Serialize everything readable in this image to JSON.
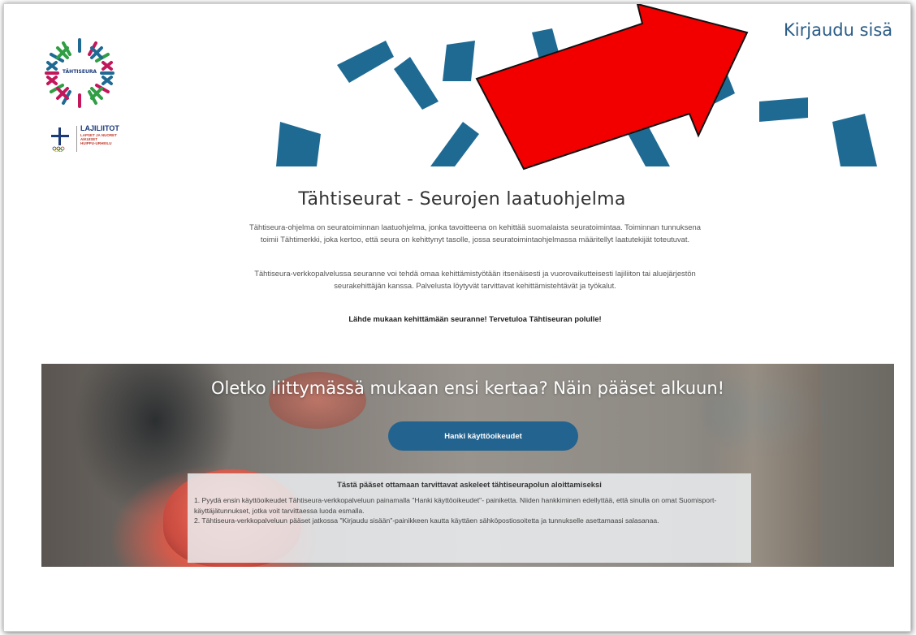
{
  "header": {
    "login_link": "Kirjaudu sisä",
    "logo_text": "TÄHTISEURA",
    "partner": {
      "title": "LAJILIITOT",
      "sub_lines": [
        "LAPSET JA NUORET",
        "AIKUISET",
        "HUIPPU-URHEILU"
      ]
    }
  },
  "intro": {
    "title": "Tähtiseurat - Seurojen laatuohjelma",
    "paragraph1": "Tähtiseura-ohjelma on seuratoiminnan laatuohjelma, jonka tavoitteena on kehittää suomalaista seuratoimintaa. Toiminnan tunnuksena toimii Tähtimerkki, joka kertoo, että seura on kehittynyt tasolle, jossa seuratoimintaohjelmassa määritellyt laatutekijät toteutuvat.",
    "paragraph2": "Tähtiseura-verkkopalvelussa seuranne voi tehdä omaa kehittämistyötään itsenäisesti ja vuorovaikutteisesti lajiliiton tai aluejärjestön seurakehittäjän kanssa. Palvelusta löytyvät tarvittavat kehittämistehtävät ja työkalut.",
    "paragraph3": "Lähde mukaan kehittämään seuranne! Tervetuloa Tähtiseuran polulle!"
  },
  "banner": {
    "heading": "Oletko liittymässä mukaan ensi kertaa? Näin pääset alkuun!",
    "button_label": "Hanki käyttöoikeudet",
    "info_title": "Tästä pääset ottamaan tarvittavat askeleet tähtiseurapolun aloittamiseksi",
    "info_lines": [
      "1. Pyydä ensin käyttöoikeudet Tähtiseura-verkkopalveluun painamalla \"Hanki käyttöoikeudet\"- painiketta. Niiden hankkiminen edellyttää, että sinulla on omat Suomisport-käyttäjätunnukset, jotka voit tarvittaessa luoda esmalla.",
      "2. Tähtiseura-verkkopalveluun pääset jatkossa \"Kirjaudu sisään\"-painikkeen kautta käyttäen sähköpostiosoitetta ja tunnukselle asettamaasi salasanaa."
    ]
  },
  "colors": {
    "brand_blue": "#1f6a93",
    "button_blue": "#23638f",
    "arrow_red": "#f20000"
  },
  "icons": {
    "star_logo": "tahtiseura-star-logo-icon",
    "olympic_cross": "olympic-cross-icon",
    "arrow": "red-arrow-annotation"
  }
}
